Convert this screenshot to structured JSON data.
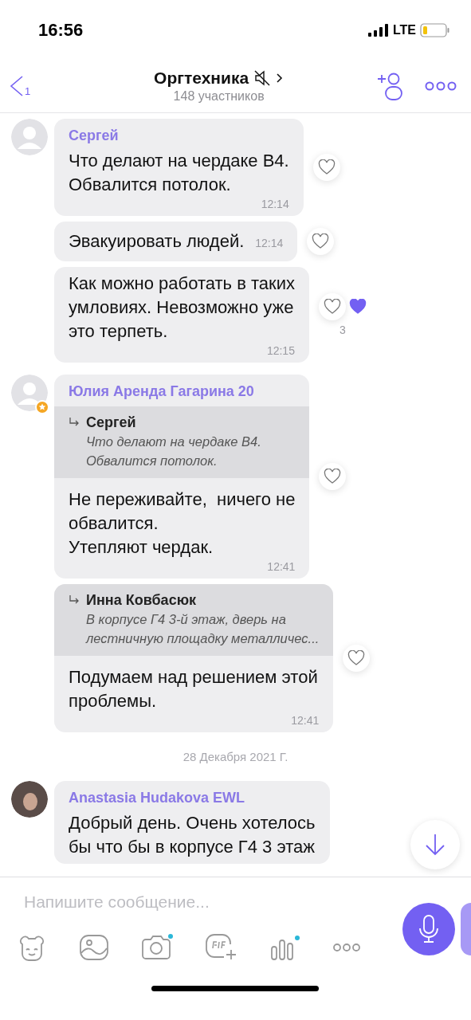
{
  "status_bar": {
    "time": "16:56",
    "network": "LTE"
  },
  "header": {
    "back_count": "1",
    "title": "Оргтехника",
    "subtitle": "148 участников",
    "muted": true
  },
  "messages": [
    {
      "kind": "message",
      "avatar": {
        "kind": "placeholder",
        "admin": false
      },
      "sender": "Сергей",
      "text": "Что делают на чердаке В4.\nОбвалится потолок.",
      "time": "12:14",
      "liked": false
    },
    {
      "kind": "inline",
      "text": "Эвакуировать людей.",
      "time": "12:14",
      "liked": false
    },
    {
      "kind": "message",
      "text": "Как можно работать в таких\nумловиях. Невозможно уже\nэто терпеть.",
      "time": "12:15",
      "liked": false,
      "others_liked": true,
      "count": "3"
    },
    {
      "kind": "message",
      "avatar": {
        "kind": "placeholder",
        "admin": true
      },
      "sender": "Юлия Аренда Гагарина 20",
      "quote": {
        "author": "Сергей",
        "text": "Что делают на чердаке В4.\nОбвалится потолок."
      },
      "text": "Не переживайте,  ничего не\nобвалится.\nУтепляют чердак.",
      "time": "12:41",
      "liked": false
    },
    {
      "kind": "message",
      "quote": {
        "author": "Инна Ковбасюк",
        "text": "В корпусе Г4 3-й этаж, дверь на\nлестничную площадку металличес..."
      },
      "text": "Подумаем над решением этой\nпроблемы.",
      "time": "12:41",
      "liked": false
    },
    {
      "kind": "date",
      "text": "28 Декабря 2021 Г."
    },
    {
      "kind": "message",
      "avatar": {
        "kind": "photo",
        "admin": false
      },
      "sender": "Anastasia Hudakova EWL",
      "text": "Добрый день. Очень хотелось\nбы что бы в корпусе Г4 3 этаж"
    }
  ],
  "composer": {
    "placeholder": "Напишите сообщение..."
  }
}
